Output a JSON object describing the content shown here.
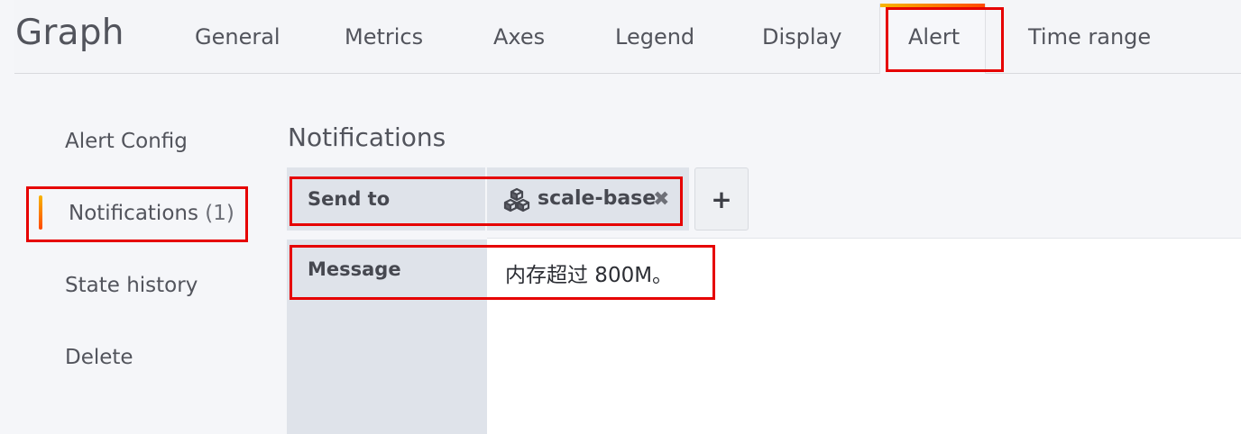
{
  "header": {
    "title": "Graph",
    "tabs": [
      {
        "label": "General"
      },
      {
        "label": "Metrics"
      },
      {
        "label": "Axes"
      },
      {
        "label": "Legend"
      },
      {
        "label": "Display"
      },
      {
        "label": "Alert"
      },
      {
        "label": "Time range"
      }
    ],
    "active_tab": "Alert"
  },
  "sidebar": {
    "items": [
      {
        "label": "Alert Config"
      },
      {
        "label": "Notifications",
        "count": "(1)"
      },
      {
        "label": "State history"
      },
      {
        "label": "Delete"
      }
    ],
    "active_item": "Notifications"
  },
  "notifications": {
    "section_title": "Notifications",
    "send_to_label": "Send to",
    "channel": {
      "name": "scale-base",
      "icon": "cubes-icon",
      "remove_glyph": "✖"
    },
    "add_glyph": "+",
    "message_label": "Message",
    "message_value": "内存超过 800M。"
  },
  "colors": {
    "accent_gradient_start": "#f7b500",
    "accent_gradient_end": "#ff4800",
    "highlight_red": "#e60000"
  }
}
